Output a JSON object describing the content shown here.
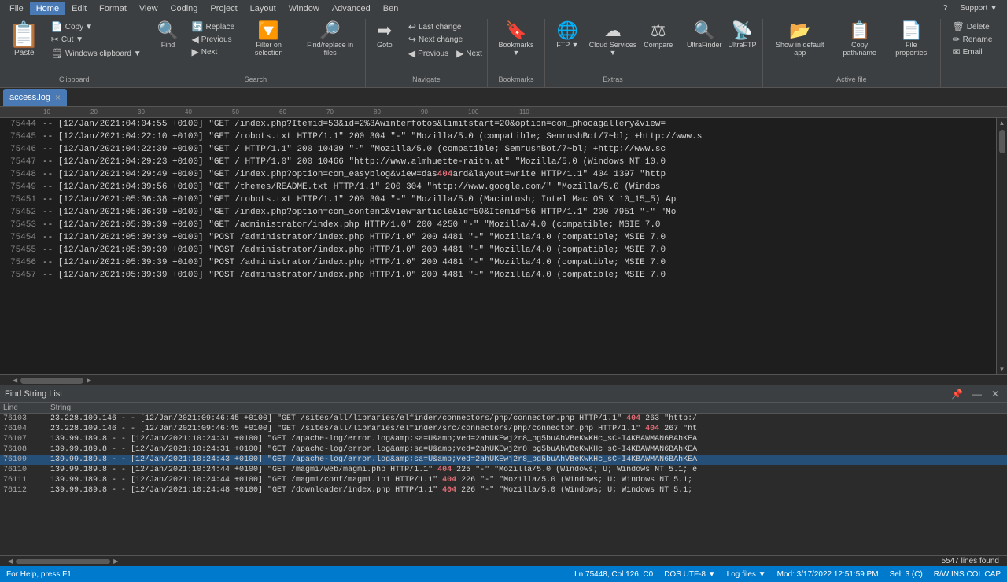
{
  "menubar": {
    "items": [
      "File",
      "Home",
      "Edit",
      "Format",
      "View",
      "Coding",
      "Project",
      "Layout",
      "Window",
      "Advanced",
      "Ben"
    ],
    "active": "Home",
    "right": [
      "?",
      "Support ▼"
    ]
  },
  "ribbon": {
    "groups": [
      {
        "label": "Clipboard",
        "paste_label": "Paste",
        "copy_label": "Copy",
        "cut_label": "Cut ▼",
        "clipboard_label": "Windows clipboard ▼"
      },
      {
        "label": "Search",
        "find_label": "Find",
        "replace_label": "Replace",
        "previous_label": "Previous",
        "next_label": "Next",
        "filter_label": "Filter on selection",
        "findreplace_label": "Find/replace in files"
      },
      {
        "label": "Navigate",
        "goto_label": "Goto",
        "lastchange_label": "Last change",
        "nextchange_label": "Next change",
        "previous2_label": "Previous",
        "next2_label": "Next"
      },
      {
        "label": "Bookmarks",
        "bookmarks_label": "Bookmarks ▼"
      },
      {
        "label": "Extras",
        "ftp_label": "FTP ▼",
        "cloudservices_label": "Cloud Services ▼",
        "compare_label": "Compare"
      },
      {
        "label": "",
        "ultrafinder_label": "UltraFinder",
        "ultraftp_label": "UltraFTP"
      },
      {
        "label": "Active file",
        "showindefault_label": "Show in default app",
        "copypathname_label": "Copy path/name",
        "fileproperties_label": "File properties"
      },
      {
        "label": "",
        "delete_label": "Delete",
        "rename_label": "Rename",
        "email_label": "Email"
      }
    ]
  },
  "tab": {
    "name": "access.log",
    "close": "×"
  },
  "editor": {
    "lines": [
      {
        "num": "75444",
        "content": " -- [12/Jan/2021:04:04:55 +0100] \"GET /index.php?Itemid=53&id=2%3Awinterfotos&limitstart=20&option=com_phocagallery&view="
      },
      {
        "num": "75445",
        "content": " -- [12/Jan/2021:04:22:10 +0100] \"GET /robots.txt HTTP/1.1\" 200 304 \"-\" \"Mozilla/5.0 (compatible; SemrushBot/7~bl; +http://www.s"
      },
      {
        "num": "75446",
        "content": " -- [12/Jan/2021:04:22:39 +0100] \"GET / HTTP/1.1\" 200 10439 \"-\" \"Mozilla/5.0 (compatible; SemrushBot/7~bl; +http://www.sc"
      },
      {
        "num": "75447",
        "content": " -- [12/Jan/2021:04:29:23 +0100] \"GET / HTTP/1.0\" 200 10466 \"http://www.almhuette-raith.at\" \"Mozilla/5.0 (Windows NT 10.0"
      },
      {
        "num": "75448",
        "content": " -- [12/Jan/2021:04:29:49 +0100] \"GET /index.php?option=com_easyblog&view=dashboard&layout=write HTTP/1.1\" 404 1397 \"http",
        "has404": true,
        "pos404": 77
      },
      {
        "num": "75449",
        "content": " -- [12/Jan/2021:04:39:56 +0100] \"GET /themes/README.txt HTTP/1.1\" 200 304 \"http://www.google.com/\" \"Mozilla/5.0 (Windos"
      },
      {
        "num": "75451",
        "content": " -- [12/Jan/2021:05:36:38 +0100] \"GET /robots.txt HTTP/1.1\" 200 304 \"-\" \"Mozilla/5.0 (Macintosh; Intel Mac OS X 10_15_5) Ap"
      },
      {
        "num": "75452",
        "content": " -- [12/Jan/2021:05:36:39 +0100] \"GET /index.php?option=com_content&view=article&id=50&Itemid=56 HTTP/1.1\" 200 7951 \"-\" \"Mo"
      },
      {
        "num": "75453",
        "content": " -- [12/Jan/2021:05:39:39 +0100] \"GET /administrator/index.php HTTP/1.0\" 200 4250 \"-\" \"Mozilla/4.0 (compatible; MSIE 7.0"
      },
      {
        "num": "75454",
        "content": " -- [12/Jan/2021:05:39:39 +0100] \"POST /administrator/index.php HTTP/1.0\" 200 4481 \"-\" \"Mozilla/4.0 (compatible; MSIE 7.0"
      },
      {
        "num": "75455",
        "content": " -- [12/Jan/2021:05:39:39 +0100] \"POST /administrator/index.php HTTP/1.0\" 200 4481 \"-\" \"Mozilla/4.0 (compatible; MSIE 7.0"
      },
      {
        "num": "75456",
        "content": " -- [12/Jan/2021:05:39:39 +0100] \"POST /administrator/index.php HTTP/1.0\" 200 4481 \"-\" \"Mozilla/4.0 (compatible; MSIE 7.0"
      },
      {
        "num": "75457",
        "content": " -- [12/Jan/2021:05:39:39 +0100] \"POST /administrator/index.php HTTP/1.0\" 200 4481 \"-\" \"Mozilla/4.0 (compatible; MSIE 7.0"
      }
    ]
  },
  "findpanel": {
    "title": "Find String List",
    "col_line": "Line",
    "col_string": "String",
    "found_count": "5547 lines found",
    "rows": [
      {
        "line": "76103",
        "text": "23.228.109.146 - - [12/Jan/2021:09:46:45 +0100] \"GET /sites/all/libraries/elfinder/connectors/php/connector.php HTTP/1.1\" ",
        "has404": true,
        "after404": "263 \"http:/"
      },
      {
        "line": "76104",
        "text": "23.228.109.146 - - [12/Jan/2021:09:46:45 +0100] \"GET /sites/all/libraries/elfinder/src/connectors/php/connector.php HTTP/1.1\" ",
        "has404": true,
        "after404": "267 \"ht"
      },
      {
        "line": "76107",
        "text": "139.99.189.8 - - [12/Jan/2021:10:24:31 +0100] \"GET /apache-log/error.log&amp;sa=U&amp;ved=2ahUKEwj2r8_bg5buAhVBeKwKHc_sC-I4KBAWMAN6BAhKEA"
      },
      {
        "line": "76108",
        "text": "139.99.189.8 - - [12/Jan/2021:10:24:31 +0100] \"GET /apache-log/error.log&amp;sa=U&amp;ved=2ahUKEwj2r8_bg5buAhVBeKwKHc_sC-I4KBAWMAN6BAhKEA"
      },
      {
        "line": "76109",
        "text": "139.99.189.8 - - [12/Jan/2021:10:24:43 +0100] \"GET /apache-log/error.log&amp;sa=U&amp;ved=2ahUKEwj2r8_bg5buAhVBeKwKHc_sC-I4KBAWMAN6BAhKEA",
        "selected": true
      },
      {
        "line": "76110",
        "text": "139.99.189.8 - - [12/Jan/2021:10:24:44 +0100] \"GET /magmi/web/magmi.php HTTP/1.1\" ",
        "has404": true,
        "after404": "225 \"-\" \"Mozilla/5.0 (Windows; U; Windows NT 5.1; e"
      },
      {
        "line": "76111",
        "text": "139.99.189.8 - - [12/Jan/2021:10:24:44 +0100] \"GET /magmi/conf/magmi.ini HTTP/1.1\" ",
        "has404": true,
        "after404": "226 \"-\" \"Mozilla/5.0 (Windows; U; Windows NT 5.1;"
      },
      {
        "line": "76112",
        "text": "139.99.189.8 - - [12/Jan/2021:10:24:48 +0100] \"GET /downloader/index.php HTTP/1.1\" ",
        "has404": true,
        "after404": "226 \"-\" \"Mozilla/5.0 (Windows; U; Windows NT 5.1;"
      }
    ]
  },
  "statusbar": {
    "help": "For Help, press F1",
    "position": "Ln 75448, Col 126, C0",
    "encoding": "DOS  UTF-8 ▼",
    "filetype": "Log files ▼",
    "modified": "Mod: 3/17/2022 12:51:59 PM",
    "sel": "Sel: 3 (C)",
    "mode": "R/W  INS  COL  CAP"
  }
}
